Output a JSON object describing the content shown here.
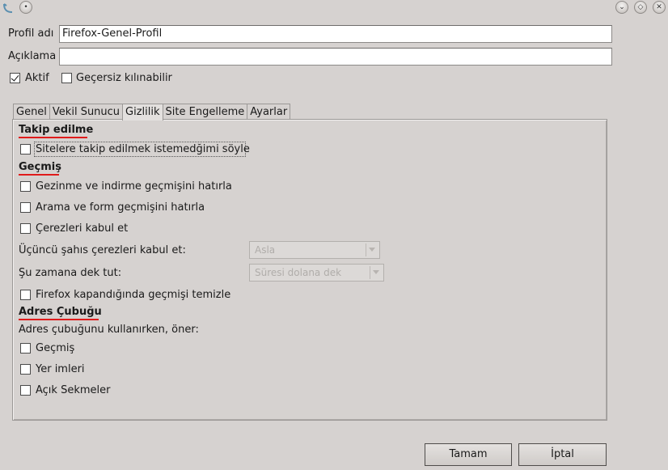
{
  "titlebar": {
    "app_icon": "kde-logo-icon",
    "menu_icon": "window-menu-icon",
    "buttons": [
      "minimize-icon",
      "maximize-icon",
      "close-icon"
    ]
  },
  "profile": {
    "name_label": "Profil adı",
    "name_value": "Firefox-Genel-Profil",
    "description_label": "Açıklama",
    "description_value": "",
    "active_label": "Aktif",
    "active_checked": true,
    "overridable_label": "Geçersiz kılınabilir",
    "overridable_checked": false
  },
  "tabs": [
    {
      "label": "Genel",
      "active": false
    },
    {
      "label": "Vekil Sunucu",
      "active": false
    },
    {
      "label": "Gizlilik",
      "active": true
    },
    {
      "label": "Site Engelleme",
      "active": false
    },
    {
      "label": "Ayarlar",
      "active": false
    }
  ],
  "privacy": {
    "tracking": {
      "title": "Takip edilme",
      "do_not_track_label": "Sitelere takip edilmek istemedğimi söyle",
      "do_not_track_checked": false
    },
    "history": {
      "title": "Geçmiş",
      "browsing_label": "Gezinme ve indirme geçmişini hatırla",
      "search_form_label": "Arama ve form geçmişini hatırla",
      "cookies_label": "Çerezleri kabul et",
      "third_party_label": "Üçüncü şahıs çerezleri kabul et:",
      "third_party_value": "Asla",
      "keep_until_label": "Şu zamana dek tut:",
      "keep_until_value": "Süresi dolana dek",
      "clear_on_close_label": "Firefox kapandığında geçmişi temizle"
    },
    "address_bar": {
      "title": "Adres Çubuğu",
      "suggest_label": "Adres çubuğunu kullanırken, öner:",
      "history_label": "Geçmiş",
      "bookmarks_label": "Yer imleri",
      "open_tabs_label": "Açık Sekmeler"
    }
  },
  "buttons": {
    "ok_label": "Tamam",
    "cancel_label": "İptal"
  },
  "colors": {
    "background": "#d6d2d0",
    "section_underline": "#e01b1b"
  }
}
